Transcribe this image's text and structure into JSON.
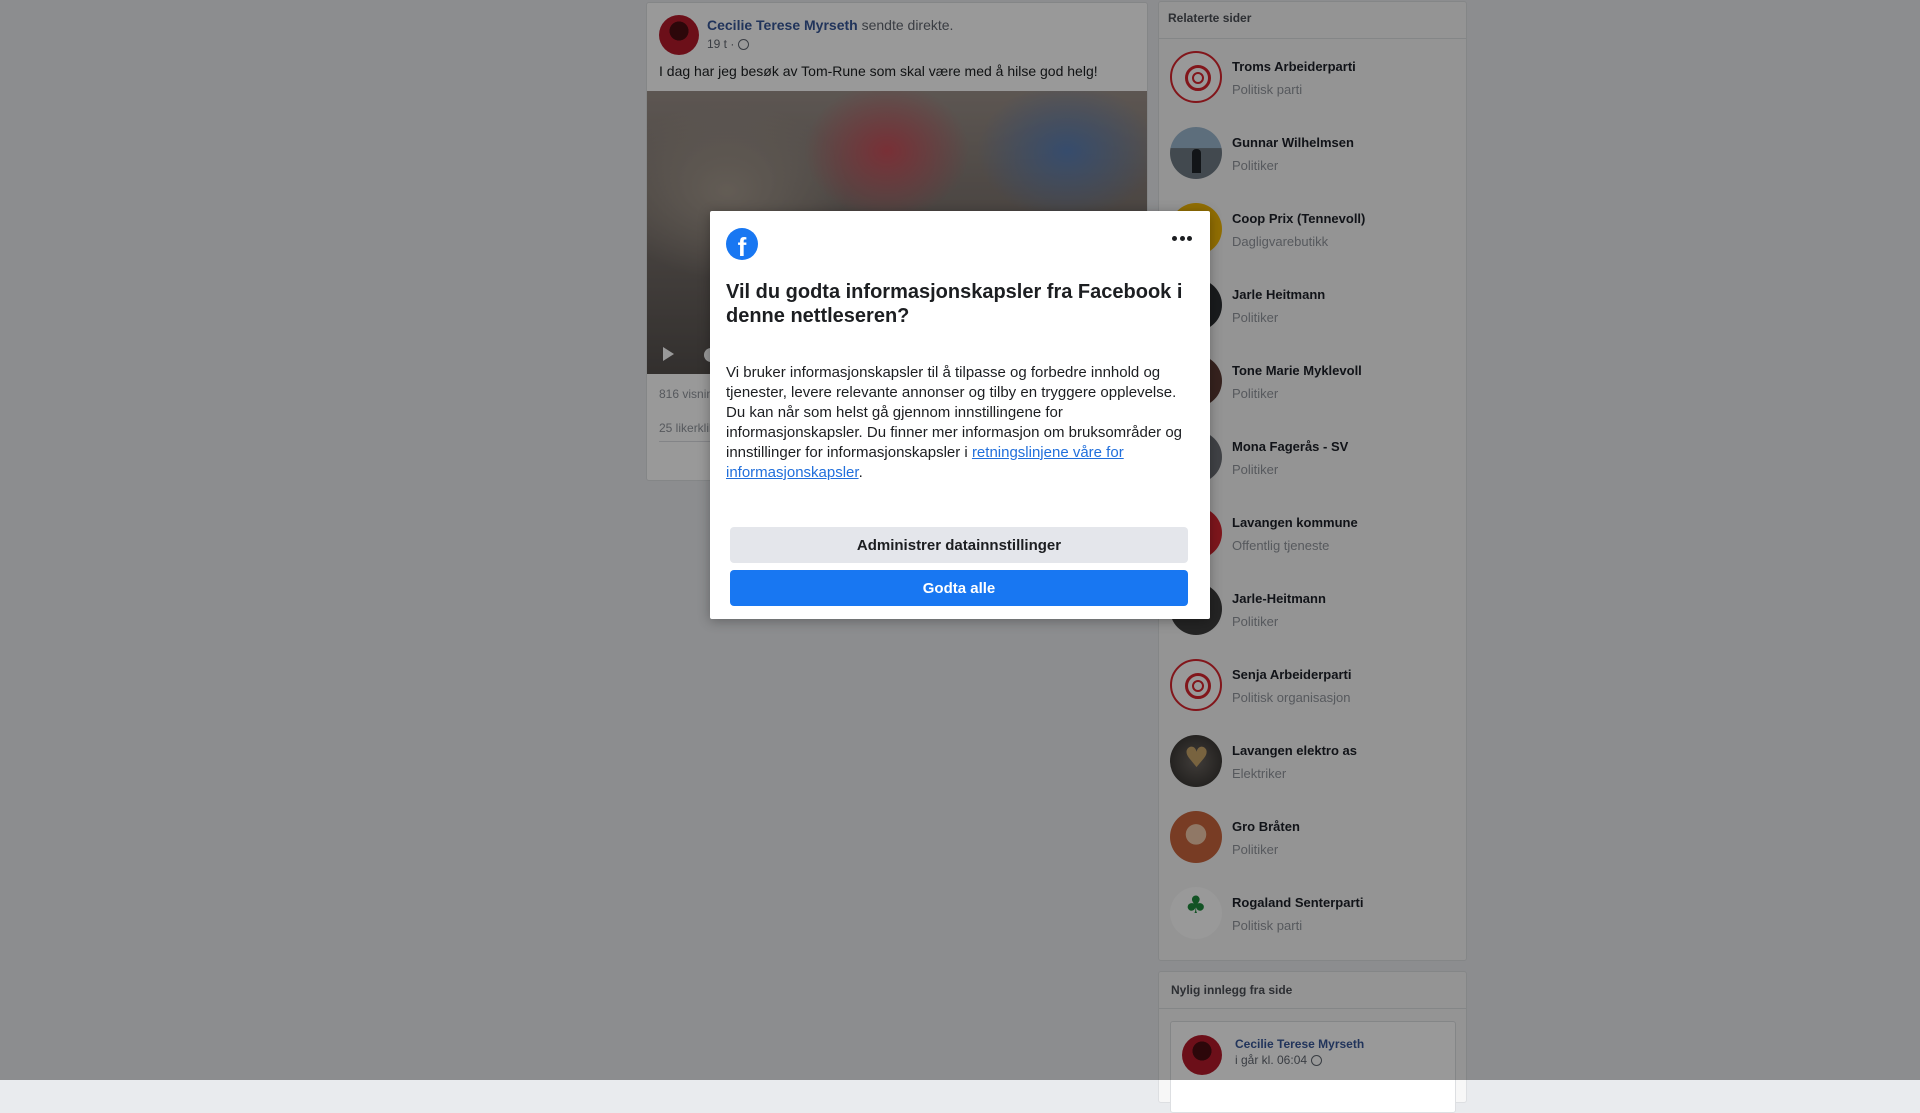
{
  "post": {
    "author": "Cecilie Terese Myrseth",
    "action": "sendte direkte.",
    "time": "19 t ·",
    "text": "I dag har jeg besøk av Tom-Rune som skal være med å hilse god helg!",
    "views": "816 visnin",
    "likes": "25 likerklik"
  },
  "related": {
    "heading": "Relaterte sider",
    "items": [
      {
        "name": "Troms Arbeiderparti",
        "category": "Politisk parti"
      },
      {
        "name": "Gunnar Wilhelmsen",
        "category": "Politiker"
      },
      {
        "name": "Coop Prix (Tennevoll)",
        "category": "Dagligvarebutikk"
      },
      {
        "name": "Jarle Heitmann",
        "category": "Politiker"
      },
      {
        "name": "Tone Marie Myklevoll",
        "category": "Politiker"
      },
      {
        "name": "Mona Fagerås - SV",
        "category": "Politiker"
      },
      {
        "name": "Lavangen kommune",
        "category": "Offentlig tjeneste"
      },
      {
        "name": "Jarle-Heitmann",
        "category": "Politiker"
      },
      {
        "name": "Senja Arbeiderparti",
        "category": "Politisk organisasjon"
      },
      {
        "name": "Lavangen elektro as",
        "category": "Elektriker"
      },
      {
        "name": "Gro Bråten",
        "category": "Politiker"
      },
      {
        "name": "Rogaland Senterparti",
        "category": "Politisk parti"
      }
    ]
  },
  "recent": {
    "heading": "Nylig innlegg fra side",
    "author": "Cecilie Terese Myrseth",
    "time": "i går kl. 06:04"
  },
  "dialog": {
    "logo": "f",
    "title": "Vil du godta informasjonskapsler fra Facebook i denne nettleseren?",
    "body": "Vi bruker informasjonskapsler til å tilpasse og forbedre innhold og tjenester, levere relevante annonser og tilby en tryggere opplevelse. Du kan når som helst gå gjennom innstillingene for informasjonskapsler. Du finner mer informasjon om bruksområder og innstillinger for informasjonskapsler i ",
    "link": "retningslinjene våre for informasjonskapsler",
    "body_end": ".",
    "manage_label": "Administrer datainnstillinger",
    "accept_label": "Godta alle"
  },
  "colors": {
    "accent": "#1877f2",
    "link": "#385898"
  },
  "icons": {
    "logo": "facebook-logo-icon",
    "menu": "more-options-icon",
    "audience": "globe-icon",
    "video": "play-icon"
  }
}
